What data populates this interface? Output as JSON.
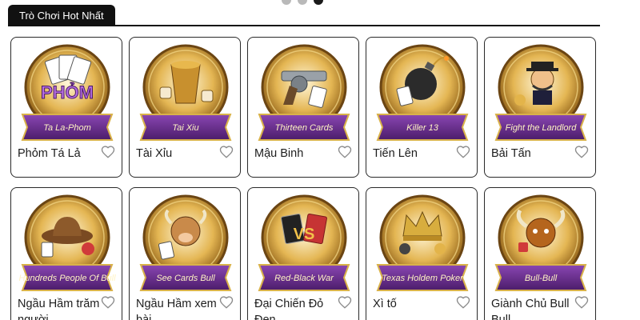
{
  "section": {
    "title": "Trò Chơi Hot Nhất"
  },
  "games": [
    {
      "name": "Phỏm Tá Lả",
      "ribbon": "Ta La-Phom",
      "art": "phom-art"
    },
    {
      "name": "Tài Xỉu",
      "ribbon": "Tai Xiu",
      "art": "dice-cup-art"
    },
    {
      "name": "Mậu Binh",
      "ribbon": "Thirteen Cards",
      "art": "revolver-art"
    },
    {
      "name": "Tiến Lên",
      "ribbon": "Killer 13",
      "art": "bomb-art"
    },
    {
      "name": "Bải Tấn",
      "ribbon": "Fight the Landlord",
      "art": "landlord-art"
    },
    {
      "name": "Ngầu Hầm trăm người",
      "ribbon": "Hundreds People Of Bull",
      "art": "cowboy-hat-art"
    },
    {
      "name": "Ngầu Hầm xem bài",
      "ribbon": "See Cards Bull",
      "art": "bull-mascot-art"
    },
    {
      "name": "Đại Chiến Đỏ Đen",
      "ribbon": "Red-Black War",
      "art": "vs-cards-art"
    },
    {
      "name": "Xì tố",
      "ribbon": "Texas Holdem Poker",
      "art": "crown-art"
    },
    {
      "name": "Giành Chủ Bull Bull",
      "ribbon": "Bull-Bull",
      "art": "bull-head-art"
    }
  ],
  "colors": {
    "gold": "#c9962f",
    "purple": "#6a2f8c",
    "dark": "#111111",
    "heart": "#8a8a8a"
  },
  "icons": {
    "favorite": "heart-outline-icon"
  }
}
